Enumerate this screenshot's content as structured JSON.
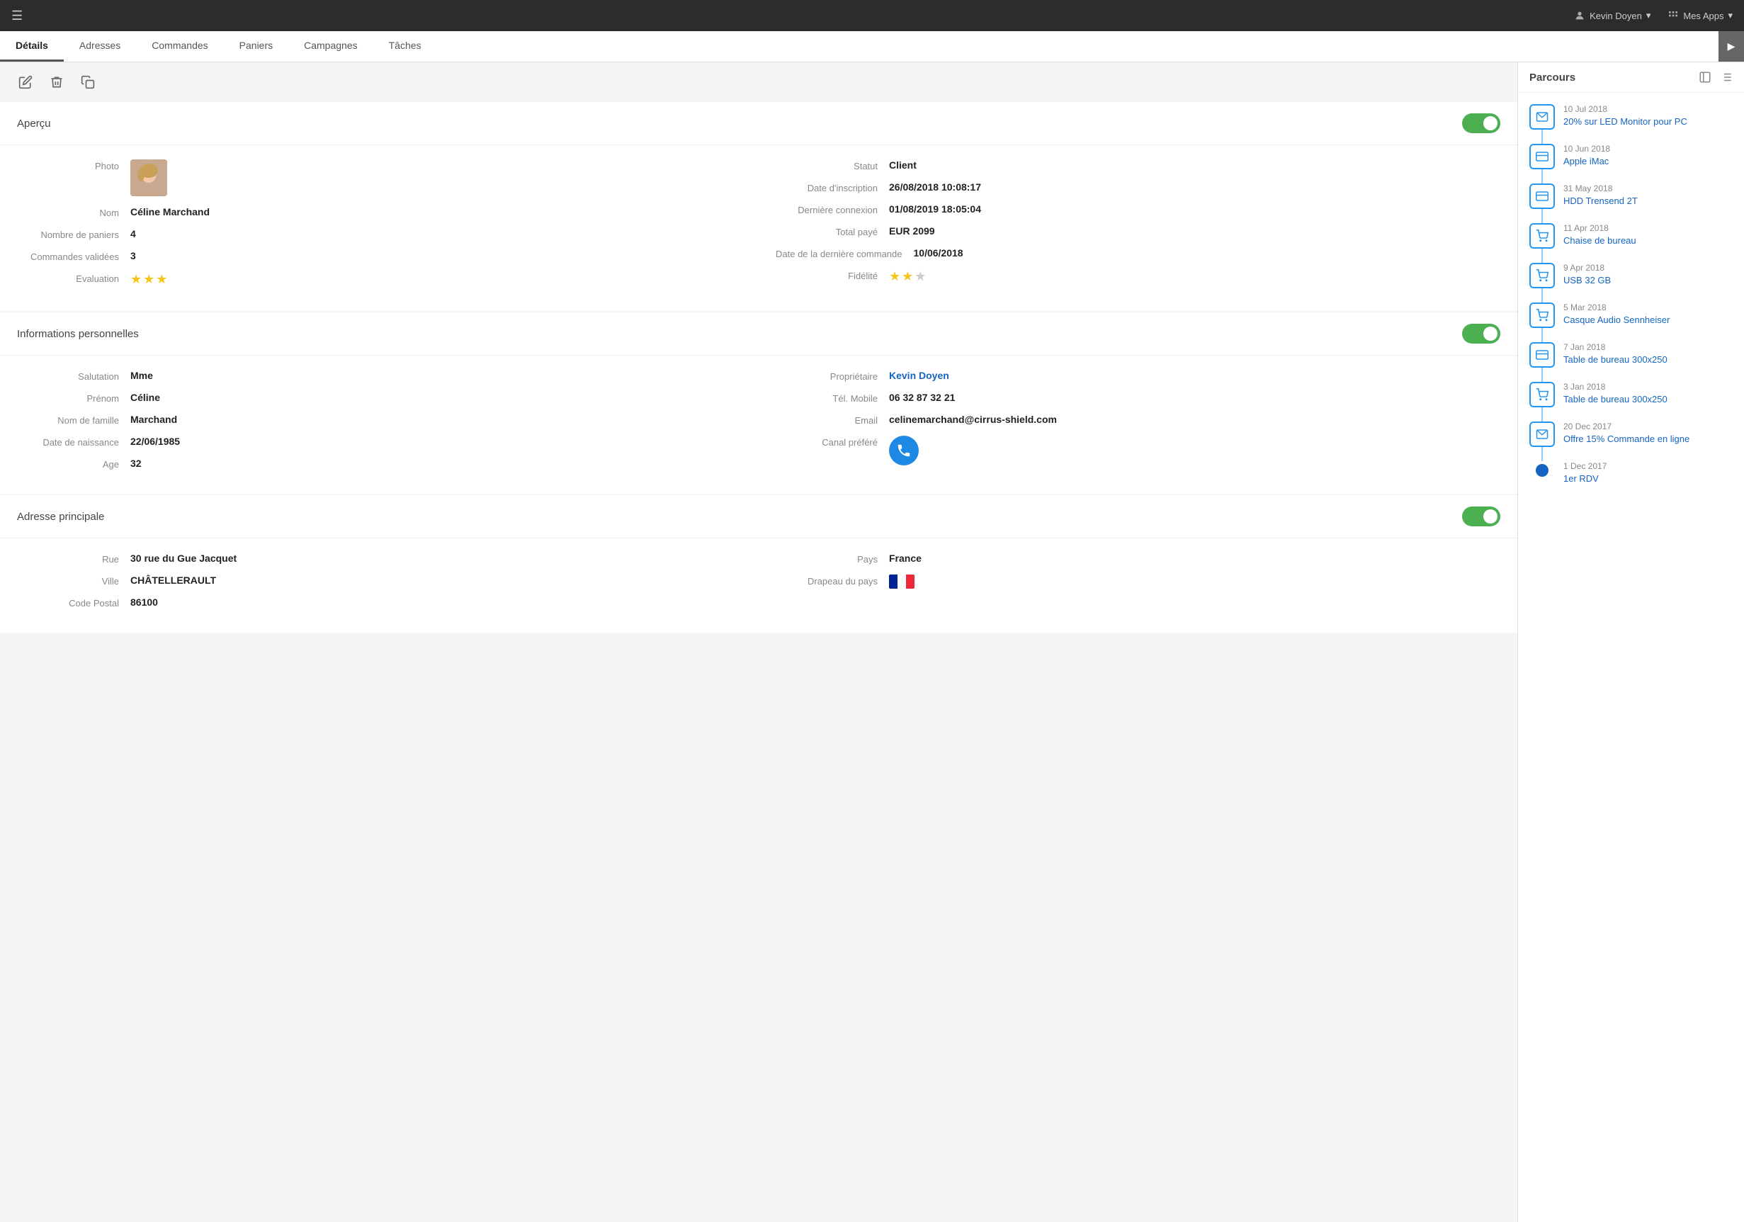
{
  "topbar": {
    "user_label": "Kevin Doyen",
    "apps_label": "Mes Apps"
  },
  "tabs": {
    "items": [
      {
        "label": "Détails",
        "active": true
      },
      {
        "label": "Adresses",
        "active": false
      },
      {
        "label": "Commandes",
        "active": false
      },
      {
        "label": "Paniers",
        "active": false
      },
      {
        "label": "Campagnes",
        "active": false
      },
      {
        "label": "Tâches",
        "active": false
      }
    ]
  },
  "sidebar_right": {
    "title": "Parcours",
    "timeline": [
      {
        "date": "10 Jul 2018",
        "label": "20% sur LED Monitor pour PC",
        "icon": "email"
      },
      {
        "date": "10 Jun 2018",
        "label": "Apple iMac",
        "icon": "credit-card"
      },
      {
        "date": "31 May 2018",
        "label": "HDD Trensend 2T",
        "icon": "credit-card"
      },
      {
        "date": "11 Apr 2018",
        "label": "Chaise de bureau",
        "icon": "cart"
      },
      {
        "date": "9 Apr 2018",
        "label": "USB 32 GB",
        "icon": "cart"
      },
      {
        "date": "5 Mar 2018",
        "label": "Casque Audio Sennheiser",
        "icon": "cart"
      },
      {
        "date": "7 Jan 2018",
        "label": "Table de bureau 300x250",
        "icon": "credit-card"
      },
      {
        "date": "3 Jan 2018",
        "label": "Table de bureau 300x250",
        "icon": "cart"
      },
      {
        "date": "20 Dec 2017",
        "label": "Offre 15% Commande en ligne",
        "icon": "email"
      },
      {
        "date": "1 Dec 2017",
        "label": "1er RDV",
        "icon": "dot"
      }
    ]
  },
  "apercu": {
    "title": "Aperçu",
    "photo_label": "Photo",
    "nom_label": "Nom",
    "nom_value": "Céline Marchand",
    "paniers_label": "Nombre de paniers",
    "paniers_value": "4",
    "commandes_label": "Commandes validées",
    "commandes_value": "3",
    "evaluation_label": "Evaluation",
    "statut_label": "Statut",
    "statut_value": "Client",
    "inscription_label": "Date d'inscription",
    "inscription_value": "26/08/2018 10:08:17",
    "connexion_label": "Dernière connexion",
    "connexion_value": "01/08/2019 18:05:04",
    "total_label": "Total payé",
    "total_value": "EUR 2099",
    "derniere_label": "Date de la dernière commande",
    "derniere_value": "10/06/2018",
    "fidelite_label": "Fidélité"
  },
  "infos": {
    "title": "Informations personnelles",
    "salutation_label": "Salutation",
    "salutation_value": "Mme",
    "prenom_label": "Prénom",
    "prenom_value": "Céline",
    "nom_label": "Nom de famille",
    "nom_value": "Marchand",
    "naissance_label": "Date de naissance",
    "naissance_value": "22/06/1985",
    "age_label": "Age",
    "age_value": "32",
    "proprietaire_label": "Propriétaire",
    "proprietaire_value": "Kevin Doyen",
    "mobile_label": "Tél. Mobile",
    "mobile_value": "06 32 87 32 21",
    "email_label": "Email",
    "email_value": "celinemarchand@cirrus-shield.com",
    "canal_label": "Canal préféré"
  },
  "adresse": {
    "title": "Adresse principale",
    "rue_label": "Rue",
    "rue_value": "30 rue du Gue Jacquet",
    "ville_label": "Ville",
    "ville_value": "CHÂTELLERAULT",
    "code_label": "Code Postal",
    "code_value": "86100",
    "pays_label": "Pays",
    "pays_value": "France",
    "drapeau_label": "Drapeau du pays"
  }
}
